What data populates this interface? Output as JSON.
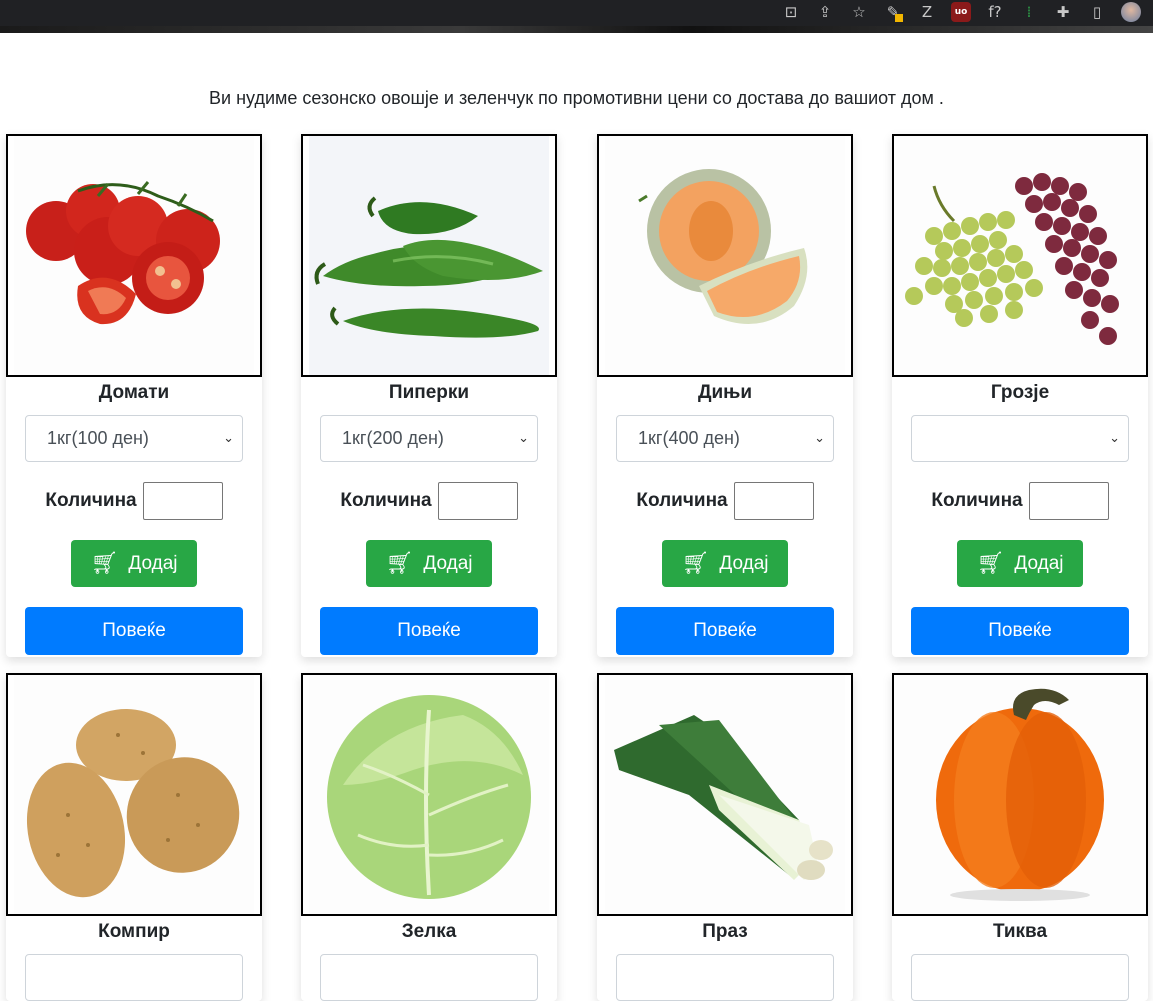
{
  "browser_toolbar": {
    "icons": [
      "translate-icon",
      "share-icon",
      "bookmark-star-icon",
      "pen-extension-icon",
      "zotero-icon",
      "ublock-icon",
      "formula-icon",
      "extension-green-icon",
      "puzzle-icon",
      "sidepanel-icon",
      "avatar"
    ],
    "ublock_text": "uo",
    "zotero_text": "Z",
    "formula_text": "f?"
  },
  "intro_text": "Ви нудиме сезонско овошје и зеленчук по промотивни цени со достава до вашиот дом .",
  "products": [
    {
      "name": "Домати",
      "option": "1кг(100 ден)",
      "qty_label": "Количина",
      "add_label": "Додај",
      "more_label": "Повеќе",
      "image": "tomatoes"
    },
    {
      "name": "Пиперки",
      "option": "1кг(200 ден)",
      "qty_label": "Количина",
      "add_label": "Додај",
      "more_label": "Повеќе",
      "image": "peppers"
    },
    {
      "name": "Дињи",
      "option": "1кг(400 ден)",
      "qty_label": "Количина",
      "add_label": "Додај",
      "more_label": "Повеќе",
      "image": "melon"
    },
    {
      "name": "Грозје",
      "option": "",
      "qty_label": "Количина",
      "add_label": "Додај",
      "more_label": "Повеќе",
      "image": "grapes"
    },
    {
      "name": "Компир",
      "image": "potatoes"
    },
    {
      "name": "Зелка",
      "image": "cabbage"
    },
    {
      "name": "Праз",
      "image": "leek"
    },
    {
      "name": "Тиква",
      "image": "pumpkin"
    }
  ],
  "colors": {
    "add_button": "#28a745",
    "more_button": "#007bff"
  }
}
